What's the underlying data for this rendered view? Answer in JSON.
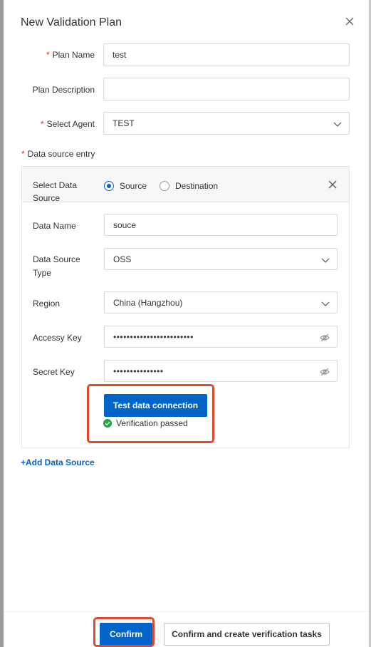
{
  "dialog": {
    "title": "New Validation Plan",
    "close_icon": "close-icon"
  },
  "form": {
    "required_mark": "*",
    "plan_name": {
      "label": "Plan Name",
      "value": "test"
    },
    "plan_description": {
      "label": "Plan Description",
      "value": ""
    },
    "select_agent": {
      "label": "Select Agent",
      "value": "TEST"
    },
    "data_source_entry_label": "Data source entry"
  },
  "data_source": {
    "select_label": "Select Data Source",
    "options": {
      "source": "Source",
      "destination": "Destination"
    },
    "selected": "source",
    "data_name": {
      "label": "Data Name",
      "value": "souce"
    },
    "type": {
      "label": "Data Source Type",
      "value": "OSS"
    },
    "region": {
      "label": "Region",
      "value": "China (Hangzhou)"
    },
    "access_key": {
      "label": "Accessy Key",
      "value": "••••••••••••••••••••••••"
    },
    "secret_key": {
      "label": "Secret Key",
      "value": "•••••••••••••••"
    },
    "test_button": "Test data connection",
    "verification_status": "Verification passed"
  },
  "add_data_source": "+Add Data Source",
  "footer": {
    "confirm": "Confirm",
    "confirm_create": "Confirm and create verification tasks"
  },
  "colors": {
    "primary": "#0064c8",
    "required": "#e0301e",
    "success": "#1fa34a",
    "highlight": "#e04a2f"
  }
}
